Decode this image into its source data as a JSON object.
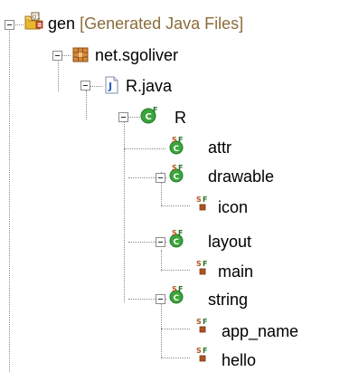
{
  "tree": {
    "project": {
      "label": "gen",
      "decoration": "[Generated Java Files]"
    },
    "package": {
      "label": "net.sgoliver"
    },
    "file": {
      "label": "R.java"
    },
    "class": {
      "label": "R"
    },
    "inner_classes": [
      {
        "label": "attr"
      },
      {
        "label": "drawable",
        "fields": [
          "icon"
        ]
      },
      {
        "label": "layout",
        "fields": [
          "main"
        ]
      },
      {
        "label": "string",
        "fields": [
          "app_name",
          "hello"
        ]
      }
    ]
  },
  "colors": {
    "decoration": "#8a6d3b",
    "tree_lines": "#8a8a8a",
    "class_green": "#3aa63a",
    "static_field_brown": "#b0541f"
  },
  "icons": {
    "project": "generated-source-folder-icon",
    "package": "package-icon",
    "file": "java-file-icon",
    "class": "class-icon",
    "inner_class": "static-final-inner-class-icon",
    "field": "static-final-field-icon"
  }
}
